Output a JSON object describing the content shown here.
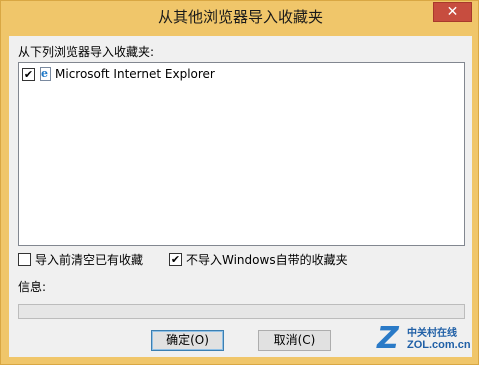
{
  "window": {
    "title": "从其他浏览器导入收藏夹",
    "close_glyph": "✕"
  },
  "source_label": "从下列浏览器导入收藏夹:",
  "browsers": [
    {
      "label": "Microsoft Internet Explorer",
      "checked": true,
      "icon": "ie-page-icon"
    }
  ],
  "options": {
    "clear_before_import": {
      "label": "导入前清空已有收藏",
      "checked": false
    },
    "skip_windows_favorites": {
      "label": "不导入Windows自带的收藏夹",
      "checked": true
    }
  },
  "info_label": "信息:",
  "progress": {
    "value": 0
  },
  "buttons": {
    "ok": "确定(O)",
    "cancel": "取消(C)"
  },
  "watermark": {
    "top_text": "中关村在线",
    "bottom_text": "ZOL.com.cn",
    "logo_letter": "Z"
  },
  "colors": {
    "frame": "#f0c66a",
    "close_button": "#c74d3f",
    "client_bg": "#f0f0f0"
  }
}
